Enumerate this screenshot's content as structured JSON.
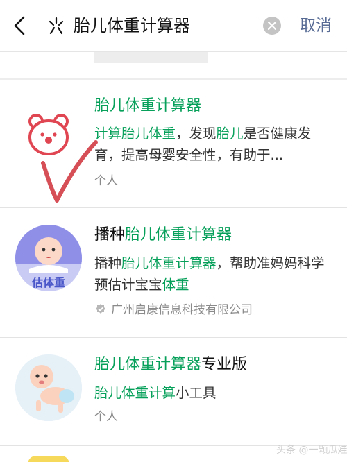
{
  "search": {
    "query": "胎儿体重计算器",
    "cancel_label": "取消"
  },
  "results": [
    {
      "title_parts": [
        {
          "text": "胎儿体重计算器",
          "highlight": true
        }
      ],
      "desc_parts": [
        {
          "text": "计算",
          "highlight": true
        },
        {
          "text": "胎儿体重",
          "highlight": true
        },
        {
          "text": "，发现",
          "highlight": false
        },
        {
          "text": "胎儿",
          "highlight": true
        },
        {
          "text": "是否健康发育，提高母婴安全性，有助于...",
          "highlight": false
        }
      ],
      "meta": "个人",
      "verified": false
    },
    {
      "title_parts": [
        {
          "text": "播种",
          "highlight": false
        },
        {
          "text": "胎儿体重计算器",
          "highlight": true
        }
      ],
      "desc_parts": [
        {
          "text": "播种",
          "highlight": false
        },
        {
          "text": "胎儿体重计算器",
          "highlight": true
        },
        {
          "text": "，帮助准妈妈科学预估计宝宝",
          "highlight": false
        },
        {
          "text": "体重",
          "highlight": true
        }
      ],
      "avatar_label": "估体重",
      "meta": "广州启康信息科技有限公司",
      "verified": true
    },
    {
      "title_parts": [
        {
          "text": "胎儿体重计算器",
          "highlight": true
        },
        {
          "text": "专业版",
          "highlight": false
        }
      ],
      "desc_parts": [
        {
          "text": "胎儿体重计算",
          "highlight": true
        },
        {
          "text": "小工具",
          "highlight": false
        }
      ],
      "meta": "个人",
      "verified": false
    }
  ],
  "watermark": "头条 @一颗瓜娃",
  "colors": {
    "highlight": "#07a05a",
    "cancel": "#576b95",
    "checkmark": "#d4464e"
  },
  "icons": {
    "back": "chevron-left-icon",
    "miniprogram": "miniprogram-icon",
    "clear": "clear-icon",
    "verified": "verified-badge-icon"
  }
}
